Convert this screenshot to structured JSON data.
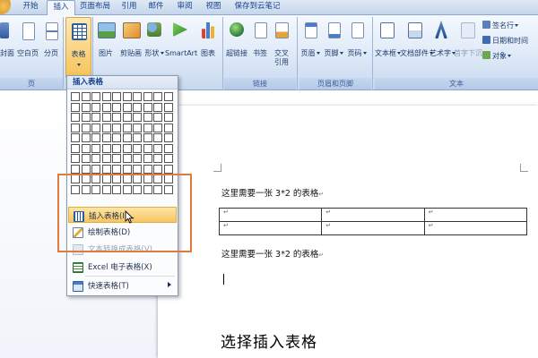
{
  "tabs": [
    "开始",
    "插入",
    "页面布局",
    "引用",
    "邮件",
    "审阅",
    "视图",
    "保存到云笔记"
  ],
  "active_tab": "插入",
  "ribbon": {
    "pages_group": {
      "label": "页",
      "cover_page": "封面",
      "blank_page": "空白页",
      "page_break": "分页"
    },
    "table_group": {
      "table": "表格"
    },
    "illustrations": {
      "picture": "图片",
      "clipart": "剪贴画",
      "shapes": "形状",
      "smartart": "SmartArt",
      "chart": "图表"
    },
    "links": {
      "label": "链接",
      "hyperlink": "超链接",
      "bookmark": "书签",
      "cross_ref": "交叉引用"
    },
    "header_footer": {
      "label": "页眉和页脚",
      "header": "页眉",
      "footer": "页脚",
      "page_number": "页码"
    },
    "text": {
      "label": "文本",
      "textbox": "文本框",
      "quickparts": "文档部件",
      "wordart": "艺术字",
      "dropcap": "首字下沉",
      "signature": "签名行",
      "datetime": "日期和时间",
      "object": "对象"
    }
  },
  "dropdown": {
    "title": "插入表格",
    "grid": {
      "rows": 10,
      "cols": 10
    },
    "items": [
      {
        "label": "插入表格(I)...",
        "icon": "insert-table-icon",
        "state": "hover"
      },
      {
        "label": "绘制表格(D)",
        "icon": "draw-table-icon",
        "state": "normal"
      },
      {
        "label": "文本转换成表格(V)...",
        "icon": "convert-text-icon",
        "state": "disabled"
      },
      {
        "label": "Excel 电子表格(X)",
        "icon": "excel-icon",
        "state": "normal"
      },
      {
        "label": "快速表格(T)",
        "icon": "quick-table-icon",
        "state": "normal",
        "submenu": true
      }
    ]
  },
  "document": {
    "line1": "这里需要一张 3*2 的表格",
    "table": {
      "rows": 2,
      "cols": 3,
      "cell_mark": "↵"
    },
    "line2": "这里需要一张 3*2 的表格",
    "para_mark": "↵"
  },
  "subtitle": "选择插入表格",
  "colors": {
    "accent_orange": "#e07b3a",
    "ribbon_text": "#15428b",
    "hover_highlight": "#f8c561"
  }
}
